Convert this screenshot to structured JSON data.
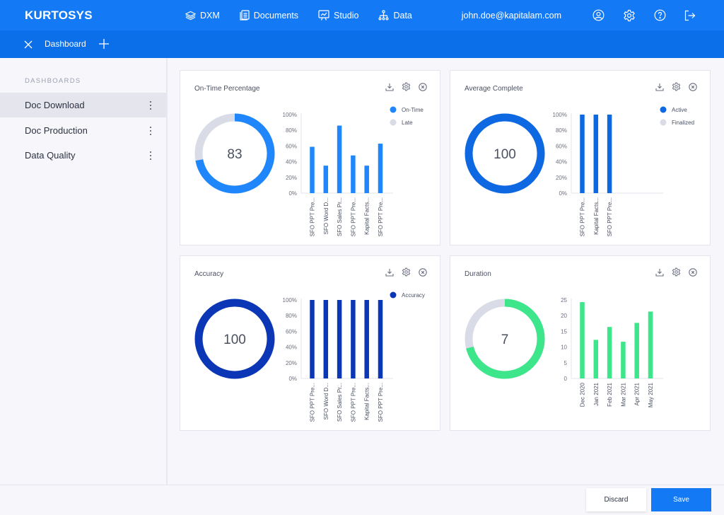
{
  "app": {
    "logo": "KURTOSYS",
    "nav": [
      {
        "label": "DXM",
        "icon": "layers-icon"
      },
      {
        "label": "Documents",
        "icon": "documents-icon"
      },
      {
        "label": "Studio",
        "icon": "presentation-icon"
      },
      {
        "label": "Data",
        "icon": "hierarchy-icon"
      }
    ],
    "user_email": "john.doe@kapitalam.com",
    "top_icons": [
      "user-icon",
      "gear-icon",
      "help-icon",
      "logout-icon"
    ]
  },
  "tabbar": {
    "active_tab": "Dashboard"
  },
  "sidebar": {
    "heading": "DASHBOARDS",
    "items": [
      {
        "label": "Doc Download",
        "active": true
      },
      {
        "label": "Doc Production",
        "active": false
      },
      {
        "label": "Data Quality",
        "active": false
      }
    ]
  },
  "footer": {
    "discard_label": "Discard",
    "save_label": "Save"
  },
  "colors": {
    "brand": "#1479f5",
    "ontime": "#1f87fb",
    "active": "#0d68e2",
    "accuracy": "#0b36b5",
    "duration": "#3de68b",
    "track": "#d9dbe6"
  },
  "chart_data": [
    {
      "type": "bar",
      "title": "On-Time Percentage",
      "donut": {
        "label": "83",
        "fraction": 0.72,
        "color": "#1f87fb",
        "track": "#d9dbe6"
      },
      "legend": [
        {
          "label": "On-Time",
          "color": "#1f87fb"
        },
        {
          "label": "Late",
          "color": "#d9dbe6"
        }
      ],
      "legend_position": "top-right",
      "categories": [
        "SFO PPT Pre...",
        "SFO Word D...",
        "SFO Sales Pr...",
        "SFO PPT Pre...",
        "Kapital Facts...",
        "SFO PPT Pre..."
      ],
      "values": [
        59,
        35,
        86,
        48,
        35,
        63
      ],
      "yticks": [
        "0%",
        "20%",
        "40%",
        "60%",
        "80%",
        "100%"
      ],
      "ylim": [
        0,
        100
      ],
      "bar_color": "#1f87fb"
    },
    {
      "type": "bar",
      "title": "Average Complete",
      "donut": {
        "label": "100",
        "fraction": 1.0,
        "color": "#0d68e2",
        "track": "#d9dbe6"
      },
      "legend": [
        {
          "label": "Active",
          "color": "#0d68e2"
        },
        {
          "label": "Finalized",
          "color": "#d9dbe6"
        }
      ],
      "legend_position": "top-right",
      "categories": [
        "SFO PPT Pre...",
        "Kapital Facts...",
        "SFO PPT Pre..."
      ],
      "values": [
        100,
        100,
        100
      ],
      "yticks": [
        "0%",
        "20%",
        "40%",
        "60%",
        "80%",
        "100%"
      ],
      "ylim": [
        0,
        100
      ],
      "bar_color": "#0d68e2"
    },
    {
      "type": "bar",
      "title": "Accuracy",
      "donut": {
        "label": "100",
        "fraction": 1.0,
        "color": "#0b36b5",
        "track": "#d9dbe6"
      },
      "legend": [
        {
          "label": "Accuracy",
          "color": "#0b36b5"
        }
      ],
      "legend_position": "top-right",
      "categories": [
        "SFO PPT Pre...",
        "SFO Word D...",
        "SFO Sales Pr...",
        "SFO PPT Pre...",
        "Kapital Facts...",
        "SFO PPT Pre..."
      ],
      "values": [
        100,
        100,
        100,
        100,
        100,
        100
      ],
      "yticks": [
        "0%",
        "20%",
        "40%",
        "60%",
        "80%",
        "100%"
      ],
      "ylim": [
        0,
        100
      ],
      "bar_color": "#0b36b5"
    },
    {
      "type": "bar",
      "title": "Duration",
      "donut": {
        "label": "7",
        "fraction": 0.71,
        "color": "#3de68b",
        "track": "#d9dbe6"
      },
      "legend": [],
      "categories": [
        "Dec 2020",
        "Jan 2021",
        "Feb 2021",
        "Mar 2021",
        "Apr 2021",
        "May 2021"
      ],
      "values": [
        24.3,
        12.3,
        16.4,
        11.7,
        17.7,
        21.3
      ],
      "yticks": [
        "0",
        "5",
        "10",
        "15",
        "20",
        "25"
      ],
      "ylim": [
        0,
        25
      ],
      "bar_color": "#3de68b"
    }
  ]
}
